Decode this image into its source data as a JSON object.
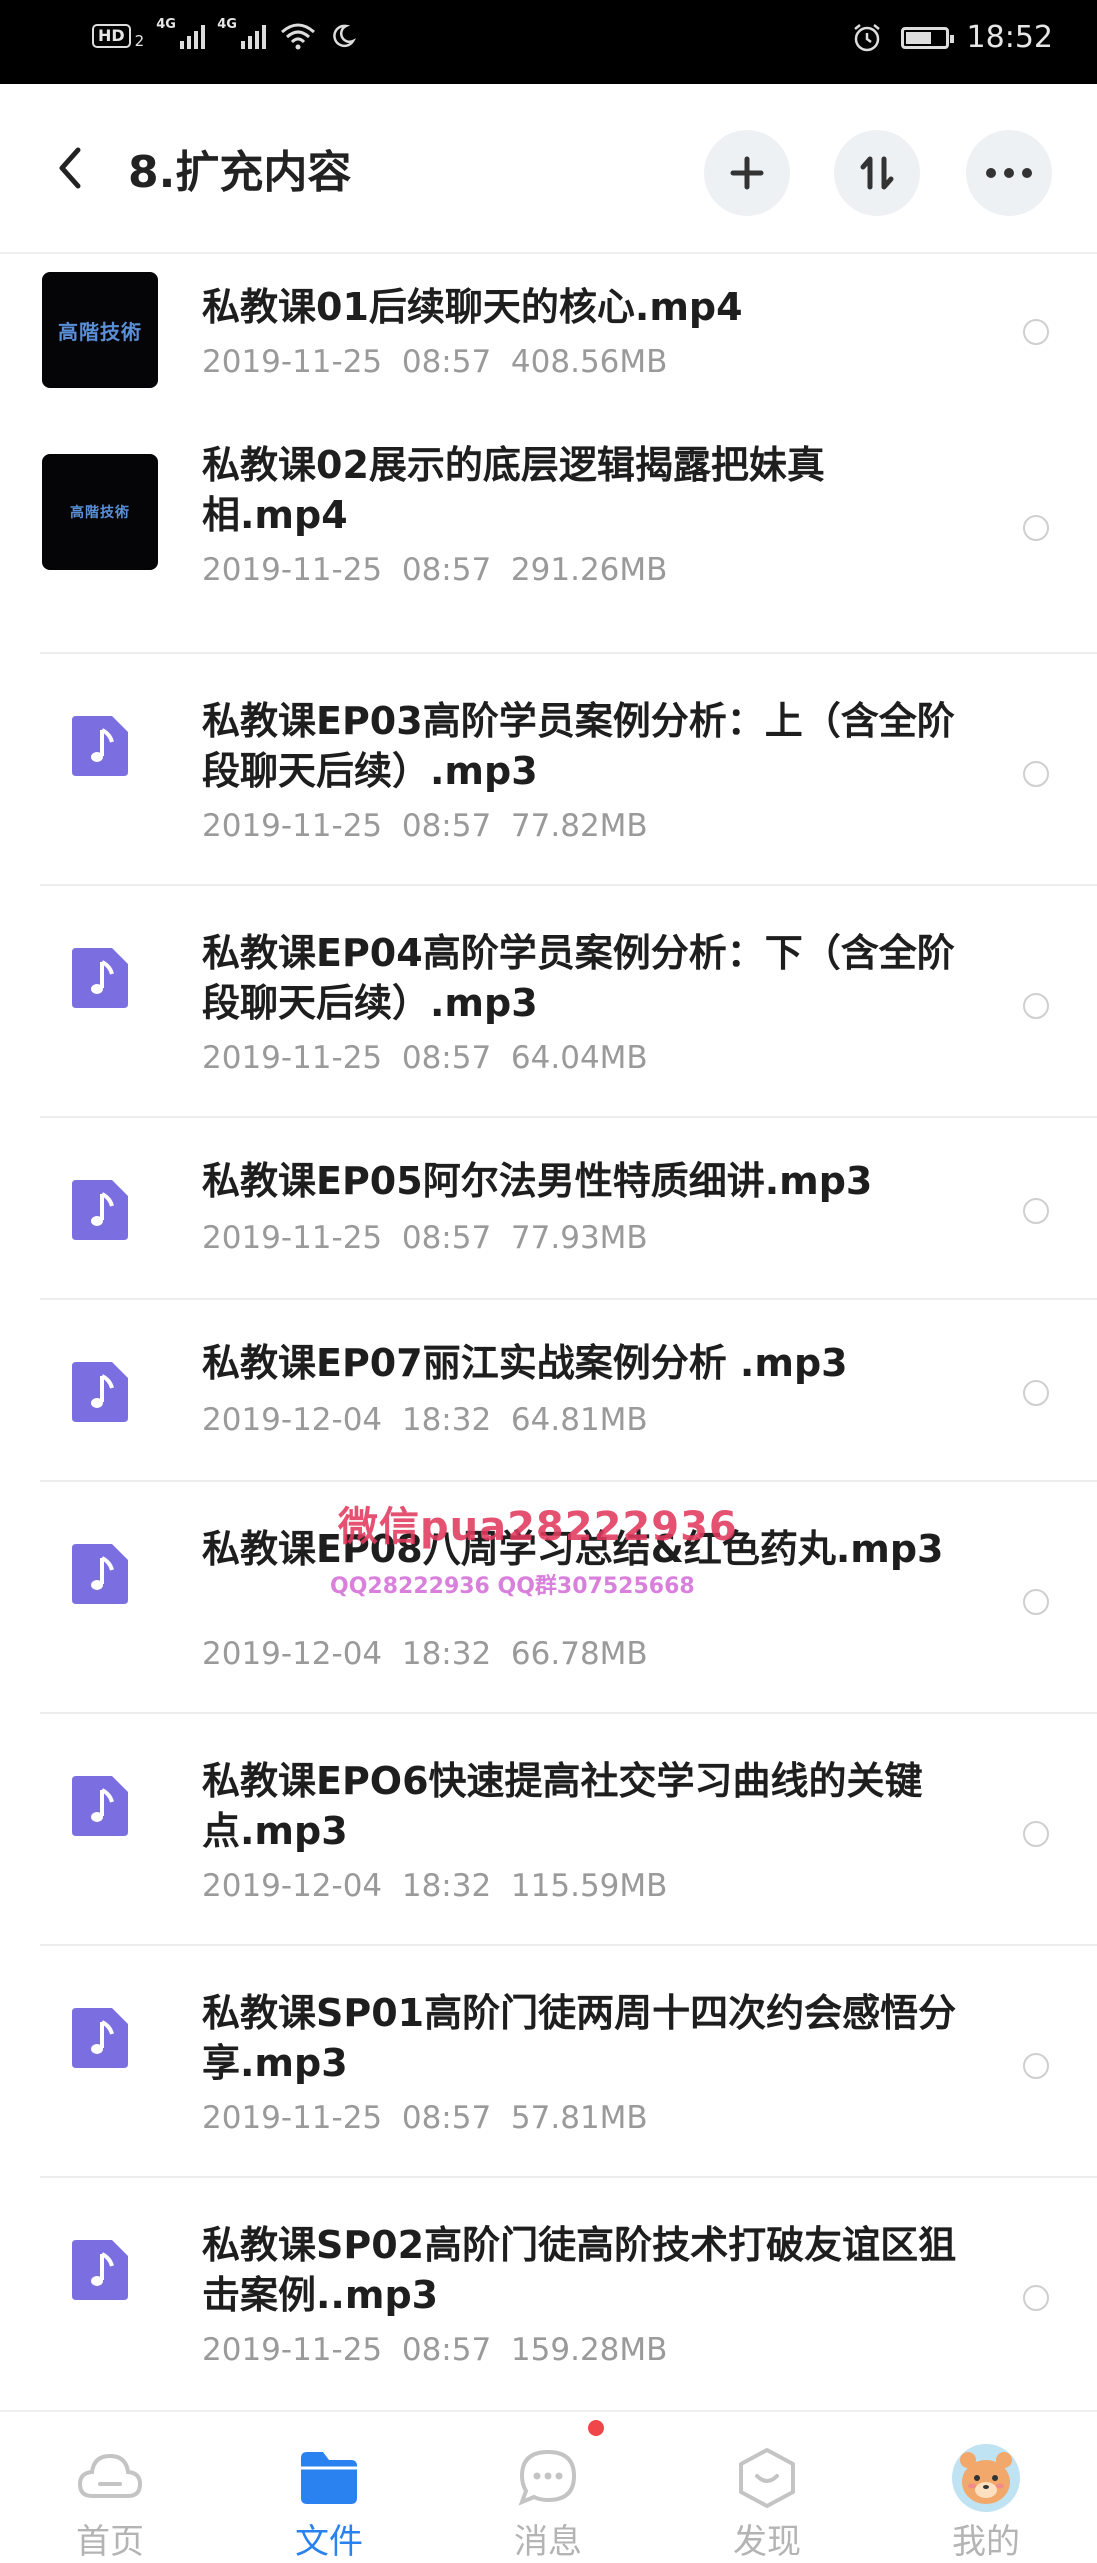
{
  "status_bar": {
    "hd": "HD",
    "hd_sub": "2",
    "net1": "4G",
    "net2": "4G",
    "time": "18:52"
  },
  "header": {
    "title": "8.扩充内容"
  },
  "files": [
    {
      "name": "私教课01后续聊天的核心.mp4",
      "date": "2019-11-25  08:57",
      "size": "408.56MB",
      "type": "video",
      "thumb_text": "高階技術"
    },
    {
      "name": "私教课02展示的底层逻辑揭露把妹真相.mp4",
      "date": "2019-11-25  08:57",
      "size": "291.26MB",
      "type": "video",
      "thumb_text": "高階技術"
    },
    {
      "name": "私教课EP03高阶学员案例分析：上（含全阶段聊天后续）.mp3",
      "date": "2019-11-25  08:57",
      "size": "77.82MB",
      "type": "audio"
    },
    {
      "name": "私教课EP04高阶学员案例分析：下（含全阶段聊天后续）.mp3",
      "date": "2019-11-25  08:57",
      "size": "64.04MB",
      "type": "audio"
    },
    {
      "name": "私教课EP05阿尔法男性特质细讲.mp3",
      "date": "2019-11-25  08:57",
      "size": "77.93MB",
      "type": "audio"
    },
    {
      "name": "私教课EP07丽江实战案例分析 .mp3",
      "date": "2019-12-04  18:32",
      "size": "64.81MB",
      "type": "audio"
    },
    {
      "name": "私教课EP08八周学习总结&红色药丸.mp3",
      "date": "2019-12-04  18:32",
      "size": "66.78MB",
      "type": "audio"
    },
    {
      "name": "私教课EPO6快速提高社交学习曲线的关键点.mp3",
      "date": "2019-12-04  18:32",
      "size": "115.59MB",
      "type": "audio"
    },
    {
      "name": "私教课SP01高阶门徒两周十四次约会感悟分享.mp3",
      "date": "2019-11-25  08:57",
      "size": "57.81MB",
      "type": "audio"
    },
    {
      "name": "私教课SP02高阶门徒高阶技术打破友谊区狙击案例..mp3",
      "date": "2019-11-25  08:57",
      "size": "159.28MB",
      "type": "audio"
    }
  ],
  "watermark": {
    "line1": "微信pua28222936",
    "line2": "QQ28222936  QQ群307525668"
  },
  "bottom_nav": [
    {
      "label": "首页",
      "icon": "cloud-icon",
      "active": false
    },
    {
      "label": "文件",
      "icon": "folder-icon",
      "active": true
    },
    {
      "label": "消息",
      "icon": "chat-icon",
      "active": false
    },
    {
      "label": "发现",
      "icon": "discover-icon",
      "active": false
    },
    {
      "label": "我的",
      "icon": "avatar-icon",
      "active": false
    }
  ],
  "colors": {
    "accent": "#2a82f0",
    "audio_icon": "#7b6ee0",
    "badge": "#f0464a"
  }
}
